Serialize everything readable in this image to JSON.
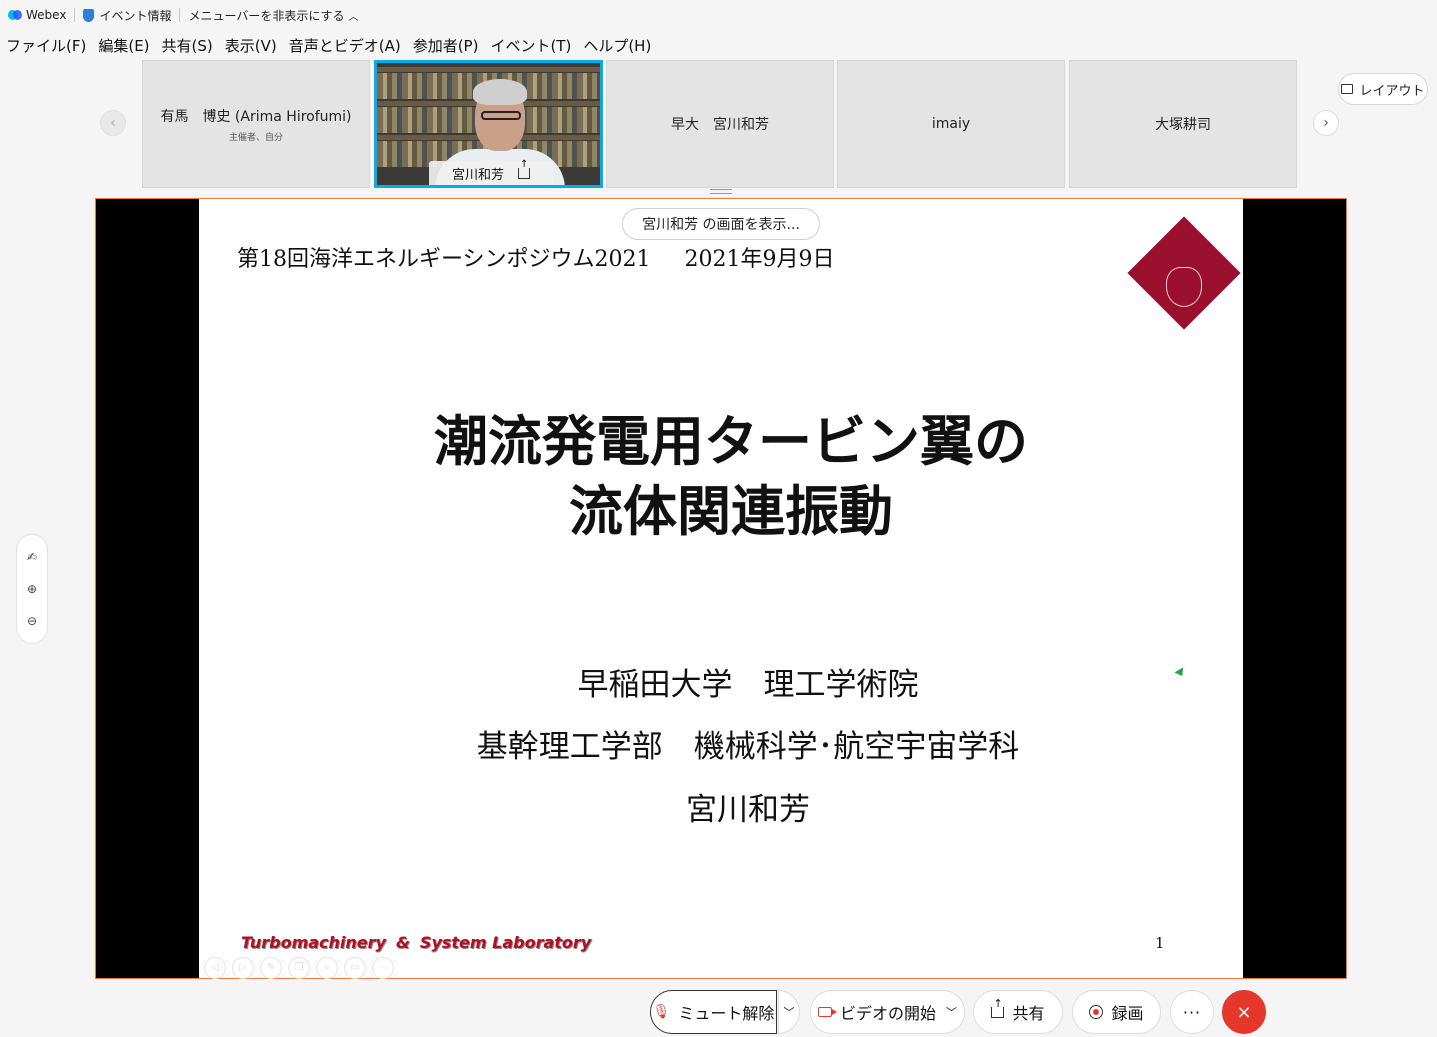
{
  "titlebar": {
    "app_name": "Webex",
    "event_info": "イベント情報",
    "hide_menu": "メニューバーを非表示にする"
  },
  "menu": [
    "ファイル(F)",
    "編集(E)",
    "共有(S)",
    "表示(V)",
    "音声とビデオ(A)",
    "参加者(P)",
    "イベント(T)",
    "ヘルプ(H)"
  ],
  "participants": [
    {
      "name": "有馬　博史 (Arima Hirofumi)",
      "sub": "主催者、自分"
    },
    {
      "name": "宮川和芳",
      "video": true
    },
    {
      "name": "早大　宮川和芳"
    },
    {
      "name": "imaiy"
    },
    {
      "name": "大塚耕司"
    }
  ],
  "layout_label": "レイアウト",
  "share_banner": "宮川和芳 の画面を表示...",
  "slide": {
    "header": "第18回海洋エネルギーシンポジウム2021",
    "date": "2021年9月9日",
    "title_line1": "潮流発電用タービン翼の",
    "title_line2": "流体関連振動",
    "affiliation1": "早稲田大学　理工学術院",
    "affiliation2": "基幹理工学部　機械科学･航空宇宙学科",
    "author": "宮川和芳",
    "lab_part1": "Turbomachinery",
    "lab_amp": "&",
    "lab_part2": "System Laboratory",
    "page_number": "1"
  },
  "controls": {
    "unmute": "ミュート解除",
    "start_video": "ビデオの開始",
    "share": "共有",
    "record": "録画",
    "more": "···",
    "end": "×"
  },
  "colors": {
    "accent": "#00aeef",
    "end_call": "#e5372b",
    "emblem": "#9a0f2e",
    "lab_text": "#b30e23",
    "stage_border": "#f07a3a"
  }
}
